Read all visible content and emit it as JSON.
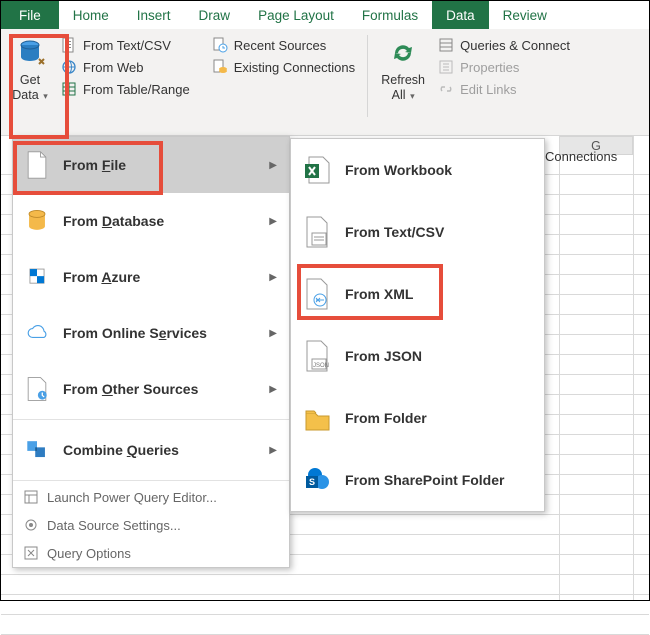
{
  "tabs": {
    "file": "File",
    "home": "Home",
    "insert": "Insert",
    "draw": "Draw",
    "page_layout": "Page Layout",
    "formulas": "Formulas",
    "data": "Data",
    "review": "Review"
  },
  "ribbon": {
    "get_data": {
      "line1": "Get",
      "line2": "Data"
    },
    "from_textcsv": "From Text/CSV",
    "from_web": "From Web",
    "from_table": "From Table/Range",
    "recent_sources": "Recent Sources",
    "existing_conn": "Existing Connections",
    "refresh_all": {
      "line1": "Refresh",
      "line2": "All"
    },
    "queries_connect": "Queries & Connect",
    "properties": "Properties",
    "edit_links": "Edit Links"
  },
  "right_panel": "Connections",
  "menu1": {
    "from_file": "From File",
    "from_database": "From Database",
    "from_azure": "From Azure",
    "from_online": "From Online Services",
    "from_other": "From Other Sources",
    "combine": "Combine Queries",
    "launch_pq": "Launch Power Query Editor...",
    "ds_settings": "Data Source Settings...",
    "query_options": "Query Options"
  },
  "menu2": {
    "from_workbook": "From Workbook",
    "from_textcsv": "From Text/CSV",
    "from_xml": "From XML",
    "from_json": "From JSON",
    "from_folder": "From Folder",
    "from_sharepoint": "From SharePoint Folder"
  },
  "columns": {
    "g": "G"
  }
}
